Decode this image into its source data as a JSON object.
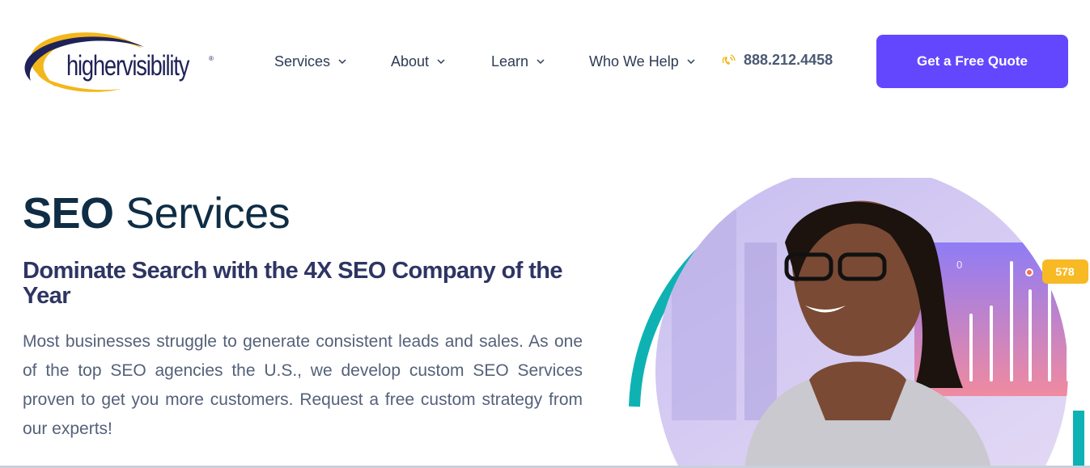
{
  "brand": {
    "logo_text": "highervisibility",
    "logo_reg": "®",
    "colors": {
      "navy": "#1f2258",
      "gold": "#f3b71b",
      "accent": "#6247ff",
      "teal": "#0fb2b2"
    }
  },
  "nav": {
    "items": [
      {
        "label": "Services",
        "icon": "chevron-down-icon"
      },
      {
        "label": "About",
        "icon": "chevron-down-icon"
      },
      {
        "label": "Learn",
        "icon": "chevron-down-icon"
      },
      {
        "label": "Who We Help",
        "icon": "chevron-down-icon"
      }
    ],
    "phone": {
      "icon": "phone-ringing-icon",
      "number": "888.212.4458"
    },
    "cta_label": "Get a Free Quote"
  },
  "hero": {
    "title_strong": "SEO",
    "title_light": "Services",
    "subtitle": "Dominate Search with the 4X SEO Company of the Year",
    "description": "Most businesses struggle to generate consistent leads and sales. As one of the top SEO agencies the U.S., we develop custom SEO Services proven to get you more customers. Request a free custom strategy from our experts!",
    "chart_badge": "578",
    "chart_axis_label": "0"
  }
}
